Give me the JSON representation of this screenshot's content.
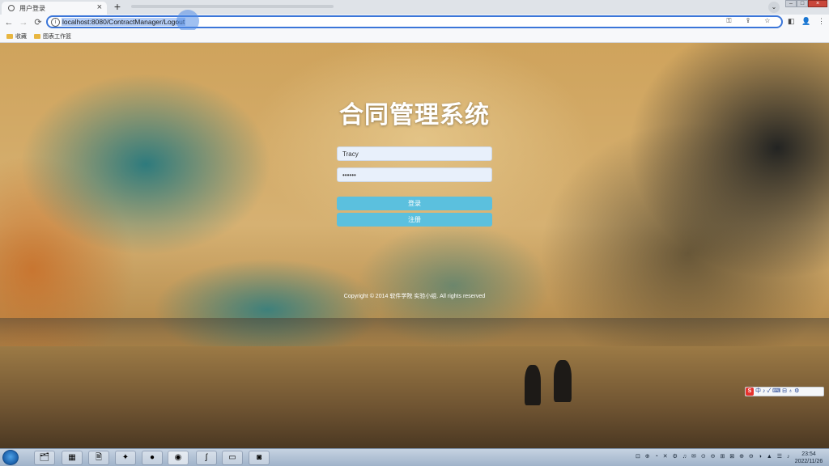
{
  "browser": {
    "tab_title": "用户登录",
    "tab_close": "×",
    "new_tab": "+",
    "tab_dropdown": "⌄",
    "window_controls": {
      "minimize": "–",
      "maximize": "□",
      "close": "×"
    },
    "nav": {
      "back": "←",
      "forward": "→",
      "reload": "⟳",
      "site_info": "i"
    },
    "url": "localhost:8080/ContractManager/Logout",
    "omnibox_icons": "⚿ ⇪ ☆",
    "toolbar_right": [
      "◧",
      "👤",
      "⋮"
    ],
    "bookmarks": [
      {
        "label": "收藏"
      },
      {
        "label": "图表工作篮"
      }
    ]
  },
  "login": {
    "title": "合同管理系统",
    "username_value": "Tracy",
    "password_value": "••••••",
    "login_button": "登录",
    "register_button": "注册",
    "footer_prefix": "Copyright © 2014 软件学院 ",
    "footer_link": "",
    "footer_suffix": " 实验小组. All rights reserved"
  },
  "ime_toolbar": {
    "logo": "S",
    "mode": "中",
    "icons": "♪ ✓ ⌨ ⊟ ♁ ⚙"
  },
  "taskbar": {
    "apps": [
      "folder",
      "app",
      "doc",
      "game",
      "chat",
      "chrome",
      "app2",
      "explorer",
      "recorder"
    ],
    "tray_icons": "⊡ ⊕ ◔ ✕ ⚙ ♫ ✉ ⊙ ⊖ ⊞ ⊠ ⊕ ⊖ ◑ ▲ ☰ ♪",
    "time": "23:54",
    "date": "2022/11/26"
  }
}
